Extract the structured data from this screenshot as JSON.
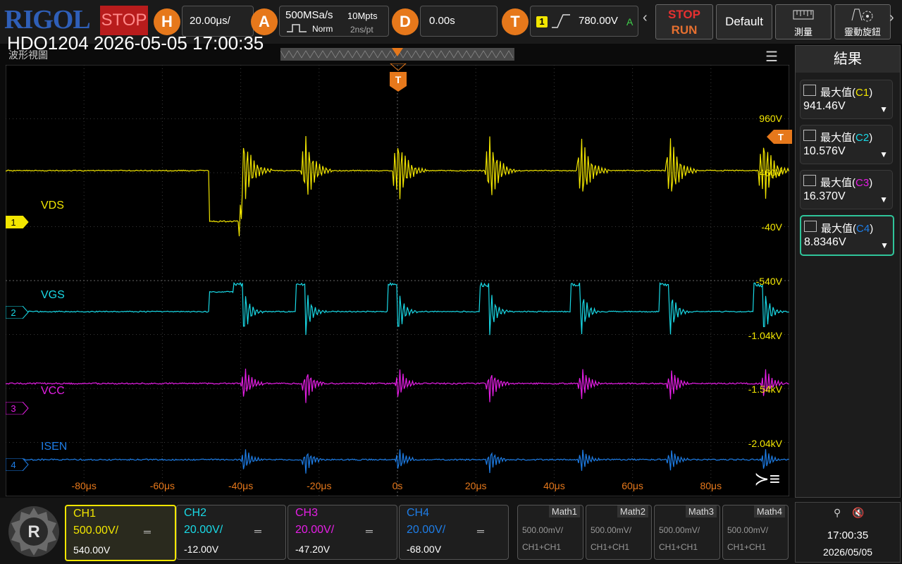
{
  "header": {
    "brand": "RIGOL",
    "run_state": "STOP",
    "horizontal": {
      "key": "H",
      "scale": "20.00μs/"
    },
    "acquire": {
      "key": "A",
      "sample_rate": "500MSa/s",
      "mode": "Norm",
      "memory_depth": "10Mpts",
      "resolution": "2ns/pt"
    },
    "delay": {
      "key": "D",
      "value": "0.00s"
    },
    "trigger": {
      "key": "T",
      "source": "1",
      "level": "780.00V",
      "coupling": "A"
    },
    "buttons": {
      "stop": "STOP",
      "run": "RUN",
      "default": "Default",
      "measure": "測量",
      "knob": "靈動旋鈕"
    }
  },
  "title": "HDO1204 2026-05-05 17:00:35",
  "view_label": "波形視圖",
  "plot": {
    "trigger_marker": "T",
    "x_ticks": [
      "-80μs",
      "-60μs",
      "-40μs",
      "-20μs",
      "0s",
      "20μs",
      "40μs",
      "60μs",
      "80μs"
    ],
    "y_labels": [
      "960V",
      "460V",
      "-40V",
      "-540V",
      "-1.04kV",
      "-1.54kV",
      "-2.04kV"
    ],
    "channels": [
      {
        "num": "1",
        "name": "VDS",
        "color": "#f2e600"
      },
      {
        "num": "2",
        "name": "VGS",
        "color": "#19d9e6"
      },
      {
        "num": "3",
        "name": "VCC",
        "color": "#e61ee6"
      },
      {
        "num": "4",
        "name": "ISEN",
        "color": "#1e7de6"
      }
    ]
  },
  "results": {
    "title": "結果",
    "items": [
      {
        "label": "最大值",
        "src": "C1",
        "value": "941.46V",
        "color": "#f2e600"
      },
      {
        "label": "最大值",
        "src": "C2",
        "value": "10.576V",
        "color": "#19d9e6"
      },
      {
        "label": "最大值",
        "src": "C3",
        "value": "16.370V",
        "color": "#e61ee6"
      },
      {
        "label": "最大值",
        "src": "C4",
        "value": "8.8346V",
        "color": "#1e7de6"
      }
    ]
  },
  "channels_bar": [
    {
      "name": "CH1",
      "scale": "500.00V/",
      "offset": "540.00V",
      "color": "#f2e600"
    },
    {
      "name": "CH2",
      "scale": "20.00V/",
      "offset": "-12.00V",
      "color": "#19d9e6"
    },
    {
      "name": "CH3",
      "scale": "20.00V/",
      "offset": "-47.20V",
      "color": "#e61ee6"
    },
    {
      "name": "CH4",
      "scale": "20.00V/",
      "offset": "-68.00V",
      "color": "#1e7de6"
    }
  ],
  "math": [
    {
      "name": "Math1",
      "scale": "500.00mV/",
      "formula": "CH1+CH1"
    },
    {
      "name": "Math2",
      "scale": "500.00mV/",
      "formula": "CH1+CH1"
    },
    {
      "name": "Math3",
      "scale": "500.00mV/",
      "formula": "CH1+CH1"
    },
    {
      "name": "Math4",
      "scale": "500.00mV/",
      "formula": "CH1+CH1"
    }
  ],
  "status": {
    "time": "17:00:35",
    "date": "2026/05/05"
  }
}
